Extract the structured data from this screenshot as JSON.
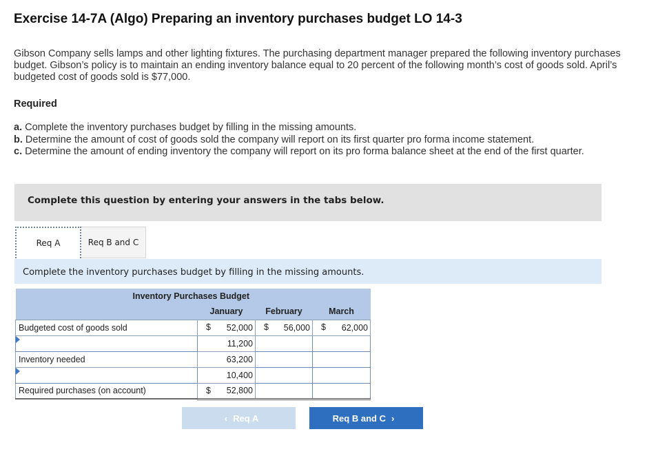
{
  "header": {
    "title": "Exercise 14-7A (Algo) Preparing an inventory purchases budget LO 14-3"
  },
  "intro": "Gibson Company sells lamps and other lighting fixtures. The purchasing department manager prepared the following inventory purchases budget. Gibson’s policy is to maintain an ending inventory balance equal to 20 percent of the following month’s cost of goods sold. April’s budgeted cost of goods sold is $77,000.",
  "required": {
    "heading": "Required",
    "a_marker": "a.",
    "a_text": "Complete the inventory purchases budget by filling in the missing amounts.",
    "b_marker": "b.",
    "b_text": "Determine the amount of cost of goods sold the company will report on its first quarter pro forma income statement.",
    "c_marker": "c.",
    "c_text": "Determine the amount of ending inventory the company will report on its pro forma balance sheet at the end of the first quarter."
  },
  "banner": "Complete this question by entering your answers in the tabs below.",
  "tabs": [
    "Req A",
    "Req B and C"
  ],
  "instruction": "Complete the inventory purchases budget by filling in the missing amounts.",
  "budget": {
    "title": "Inventory Purchases Budget",
    "columns": [
      "January",
      "February",
      "March"
    ],
    "currency": "$",
    "rows": {
      "cogs": {
        "label": "Budgeted cost of goods sold",
        "jan": "52,000",
        "feb": "56,000",
        "mar": "62,000"
      },
      "plus_end": {
        "label": "",
        "jan": "11,200",
        "feb": "",
        "mar": ""
      },
      "needed": {
        "label": "Inventory needed",
        "jan": "63,200",
        "feb": "",
        "mar": ""
      },
      "less_begin": {
        "label": "",
        "jan": "10,400",
        "feb": "",
        "mar": ""
      },
      "purchases": {
        "label": "Required purchases (on account)",
        "jan": "52,800",
        "feb": "",
        "mar": ""
      }
    }
  },
  "nav": {
    "prev": "Req A",
    "next": "Req B and C",
    "prev_icon": "chevron-left-icon",
    "next_icon": "chevron-right-icon"
  }
}
